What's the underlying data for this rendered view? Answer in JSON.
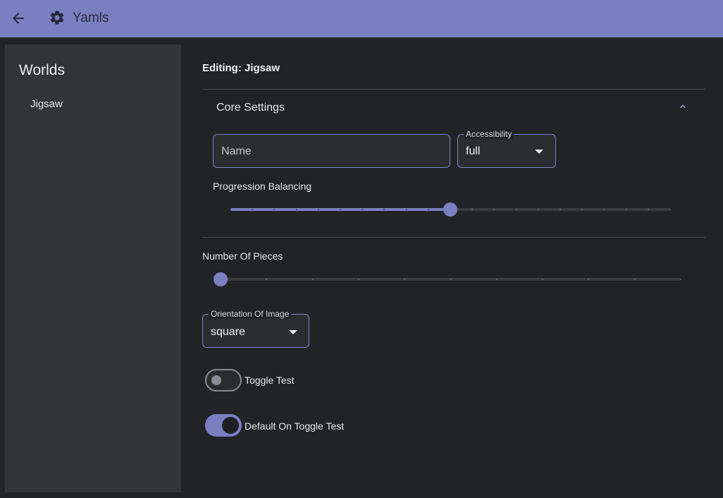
{
  "appbar": {
    "title": "Yamls",
    "back_icon": "arrow-left-icon",
    "settings_icon": "gear-icon",
    "color": "#7a7fc2"
  },
  "sidebar": {
    "heading": "Worlds",
    "items": [
      {
        "label": "Jigsaw"
      }
    ]
  },
  "editor": {
    "editing_title": "Editing: Jigsaw",
    "core_settings": {
      "title": "Core Settings",
      "expanded": true,
      "name_field": {
        "placeholder": "Name",
        "value": ""
      },
      "accessibility": {
        "label": "Accessibility",
        "value": "full"
      },
      "progression_balancing": {
        "label": "Progression Balancing",
        "steps": 20,
        "value_fraction": 0.5
      }
    },
    "number_of_pieces": {
      "label": "Number Of Pieces",
      "steps": 10,
      "value_fraction": 0.0
    },
    "orientation_of_image": {
      "label": "Orientation Of Image",
      "value": "square"
    },
    "toggles": [
      {
        "label": "Toggle Test",
        "on": false
      },
      {
        "label": "Default On Toggle Test",
        "on": true
      }
    ]
  },
  "colors": {
    "accent": "#7a7fc2",
    "background": "#212327",
    "sidebar": "#343538"
  }
}
